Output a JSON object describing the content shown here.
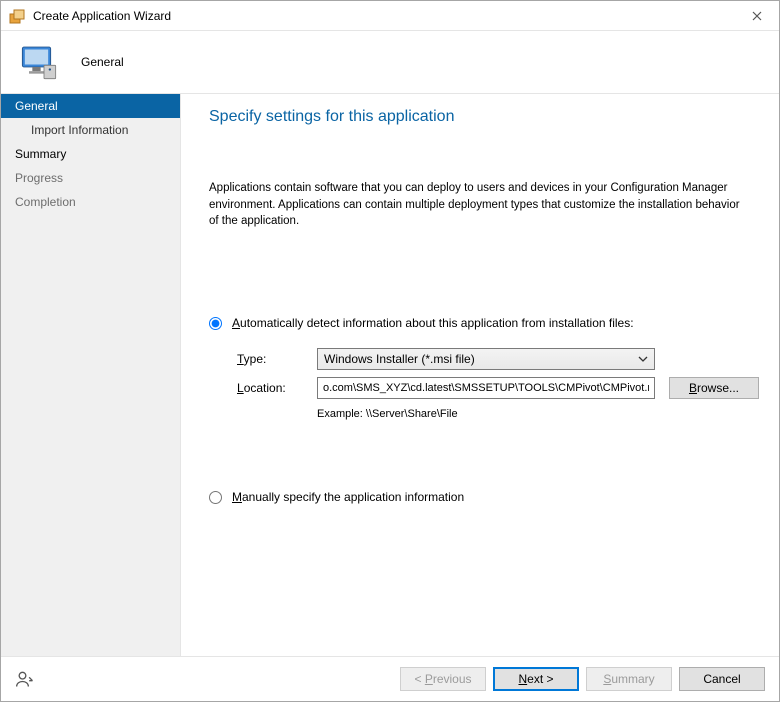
{
  "window": {
    "title": "Create Application Wizard"
  },
  "banner": {
    "title": "General"
  },
  "sidebar": {
    "items": [
      {
        "label": "General",
        "selected": true,
        "sub": false
      },
      {
        "label": "Import Information",
        "selected": false,
        "sub": true
      },
      {
        "label": "Summary",
        "selected": false,
        "sub": false
      },
      {
        "label": "Progress",
        "selected": false,
        "sub": false
      },
      {
        "label": "Completion",
        "selected": false,
        "sub": false
      }
    ]
  },
  "page": {
    "title": "Specify settings for this application",
    "description": "Applications contain software that you can deploy to users and devices in your Configuration Manager environment. Applications can contain multiple deployment types that customize the installation behavior of the application.",
    "auto_detect_label": "Automatically detect information about this application from installation files:",
    "manual_label": "Manually specify the application information",
    "type_label": "Type:",
    "location_label": "Location:",
    "type_value": "Windows Installer (*.msi file)",
    "location_value": "o.com\\SMS_XYZ\\cd.latest\\SMSSETUP\\TOOLS\\CMPivot\\CMPivot.msi",
    "example_label": "Example: \\\\Server\\Share\\File",
    "browse_label": "Browse..."
  },
  "footer": {
    "previous": "< Previous",
    "next": "Next >",
    "summary": "Summary",
    "cancel": "Cancel"
  }
}
